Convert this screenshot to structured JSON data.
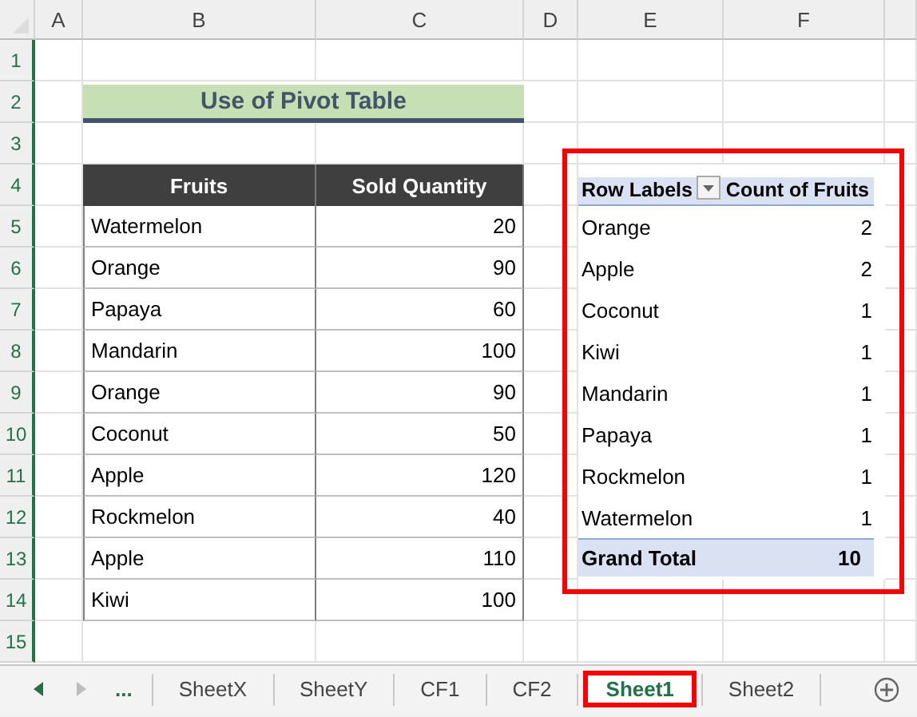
{
  "column_headers": [
    "A",
    "B",
    "C",
    "D",
    "E",
    "F"
  ],
  "row_headers": [
    "1",
    "2",
    "3",
    "4",
    "5",
    "6",
    "7",
    "8",
    "9",
    "10",
    "11",
    "12",
    "13",
    "14",
    "15"
  ],
  "title": "Use of Pivot Table",
  "source_table": {
    "columns": [
      "Fruits",
      "Sold Quantity"
    ],
    "rows": [
      [
        "Watermelon",
        "20"
      ],
      [
        "Orange",
        "90"
      ],
      [
        "Papaya",
        "60"
      ],
      [
        "Mandarin",
        "100"
      ],
      [
        "Orange",
        "90"
      ],
      [
        "Coconut",
        "50"
      ],
      [
        "Apple",
        "120"
      ],
      [
        "Rockmelon",
        "40"
      ],
      [
        "Apple",
        "110"
      ],
      [
        "Kiwi",
        "100"
      ]
    ]
  },
  "pivot_table": {
    "columns": [
      "Row Labels",
      "Count of Fruits"
    ],
    "rows": [
      [
        "Orange",
        "2"
      ],
      [
        "Apple",
        "2"
      ],
      [
        "Coconut",
        "1"
      ],
      [
        "Kiwi",
        "1"
      ],
      [
        "Mandarin",
        "1"
      ],
      [
        "Papaya",
        "1"
      ],
      [
        "Rockmelon",
        "1"
      ],
      [
        "Watermelon",
        "1"
      ]
    ],
    "total": [
      "Grand Total",
      "10"
    ]
  },
  "sheet_tabs": {
    "overflow": "...",
    "tabs": [
      {
        "label": "SheetX",
        "selected": false
      },
      {
        "label": "SheetY",
        "selected": false
      },
      {
        "label": "CF1",
        "selected": false
      },
      {
        "label": "CF2",
        "selected": false
      },
      {
        "label": "Sheet1",
        "selected": true
      },
      {
        "label": "Sheet2",
        "selected": false
      }
    ]
  }
}
